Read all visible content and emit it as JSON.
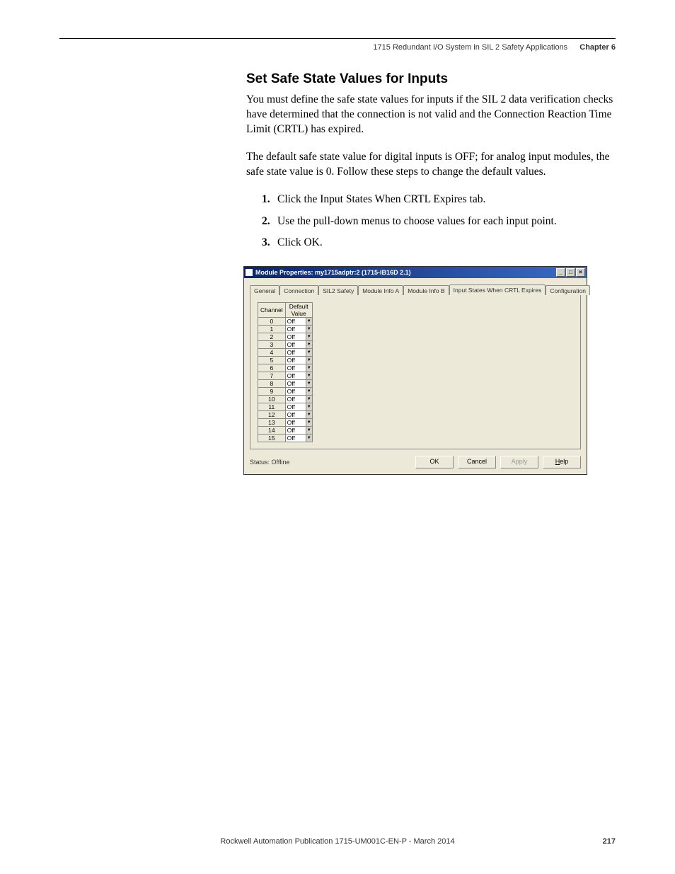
{
  "header": {
    "running_title": "1715 Redundant I/O System in SIL 2 Safety Applications",
    "chapter": "Chapter 6"
  },
  "section": {
    "heading": "Set Safe State Values for Inputs",
    "para1": "You must define the safe state values for inputs if the SIL 2 data verification checks have determined that the connection is not valid and the Connection Reaction Time Limit (CRTL) has expired.",
    "para2": "The default safe state value for digital inputs is OFF; for analog input modules, the safe state value is 0. Follow these steps to change the default values.",
    "steps": [
      "Click the Input States When CRTL Expires tab.",
      "Use the pull-down menus to choose values for each input point.",
      "Click OK."
    ]
  },
  "dialog": {
    "title": "Module Properties: my1715adptr:2 (1715-IB16D 2.1)",
    "tabs": [
      "General",
      "Connection",
      "SIL2 Safety",
      "Module Info A",
      "Module Info B",
      "Input States When CRTL Expires",
      "Configuration"
    ],
    "active_tab": 5,
    "table_headers": {
      "channel": "Channel",
      "value": "Default Value"
    },
    "channels": [
      {
        "ch": "0",
        "val": "Off"
      },
      {
        "ch": "1",
        "val": "Off"
      },
      {
        "ch": "2",
        "val": "Off"
      },
      {
        "ch": "3",
        "val": "Off"
      },
      {
        "ch": "4",
        "val": "Off"
      },
      {
        "ch": "5",
        "val": "Off"
      },
      {
        "ch": "6",
        "val": "Off"
      },
      {
        "ch": "7",
        "val": "Off"
      },
      {
        "ch": "8",
        "val": "Off"
      },
      {
        "ch": "9",
        "val": "Off"
      },
      {
        "ch": "10",
        "val": "Off"
      },
      {
        "ch": "11",
        "val": "Off"
      },
      {
        "ch": "12",
        "val": "Off"
      },
      {
        "ch": "13",
        "val": "Off"
      },
      {
        "ch": "14",
        "val": "Off"
      },
      {
        "ch": "15",
        "val": "Off"
      }
    ],
    "status": "Status: Offline",
    "buttons": {
      "ok": "OK",
      "cancel": "Cancel",
      "apply": "Apply",
      "help": "Help"
    }
  },
  "footer": {
    "publication": "Rockwell Automation Publication 1715-UM001C-EN-P - March 2014",
    "page": "217"
  }
}
